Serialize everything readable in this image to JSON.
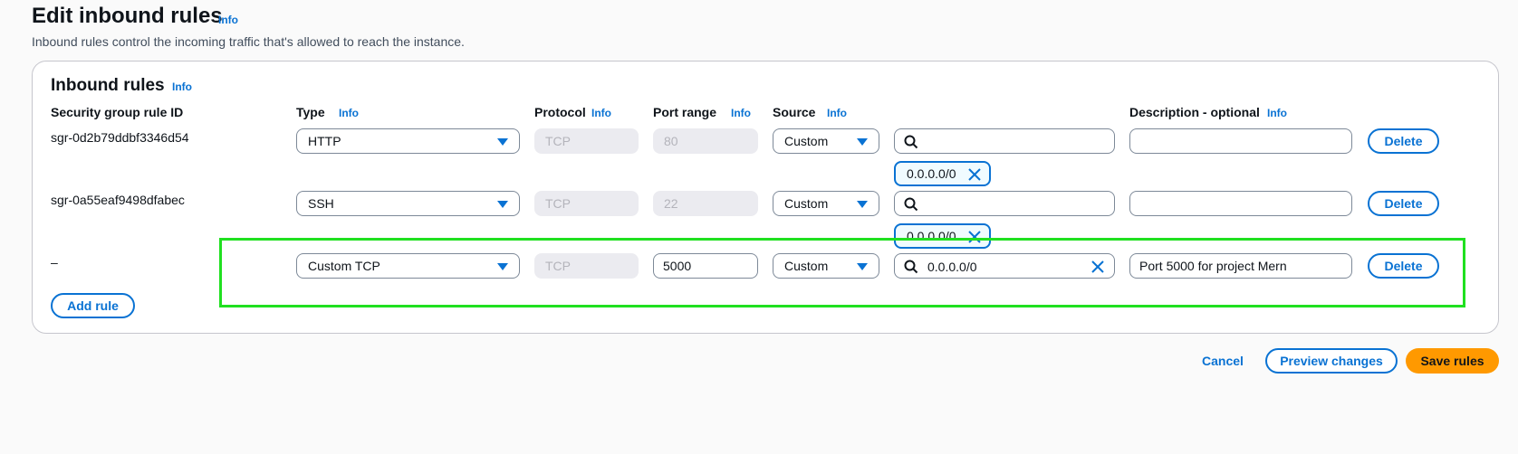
{
  "page": {
    "title": "Edit inbound rules",
    "title_info": "Info",
    "description": "Inbound rules control the incoming traffic that's allowed to reach the instance."
  },
  "panel": {
    "title": "Inbound rules",
    "info": "Info"
  },
  "columns": {
    "rule_id": "Security group rule ID",
    "type": "Type",
    "type_info": "Info",
    "protocol": "Protocol",
    "protocol_info": "Info",
    "port_range": "Port range",
    "port_range_info": "Info",
    "source": "Source",
    "source_info": "Info",
    "description": "Description - optional",
    "description_info": "Info"
  },
  "rules": [
    {
      "rule_id": "sgr-0d2b79ddbf3346d54",
      "type": "HTTP",
      "protocol": "TCP",
      "port_range": "80",
      "source": "Custom",
      "source_search": "",
      "source_token": "0.0.0.0/0",
      "description": "",
      "delete_label": "Delete"
    },
    {
      "rule_id": "sgr-0a55eaf9498dfabec",
      "type": "SSH",
      "protocol": "TCP",
      "port_range": "22",
      "source": "Custom",
      "source_search": "",
      "source_token": "0.0.0.0/0",
      "description": "",
      "delete_label": "Delete"
    },
    {
      "rule_id": "–",
      "type": "Custom TCP",
      "protocol": "TCP",
      "port_range": "5000",
      "source": "Custom",
      "source_search": "0.0.0.0/0",
      "description": "Port 5000 for project Mern",
      "delete_label": "Delete"
    }
  ],
  "add_rule_label": "Add rule",
  "footer": {
    "cancel_label": "Cancel",
    "preview_label": "Preview changes",
    "save_label": "Save rules"
  },
  "colors": {
    "accent": "#0972d3",
    "primary_button": "#ff9900",
    "highlight": "#20e020"
  }
}
